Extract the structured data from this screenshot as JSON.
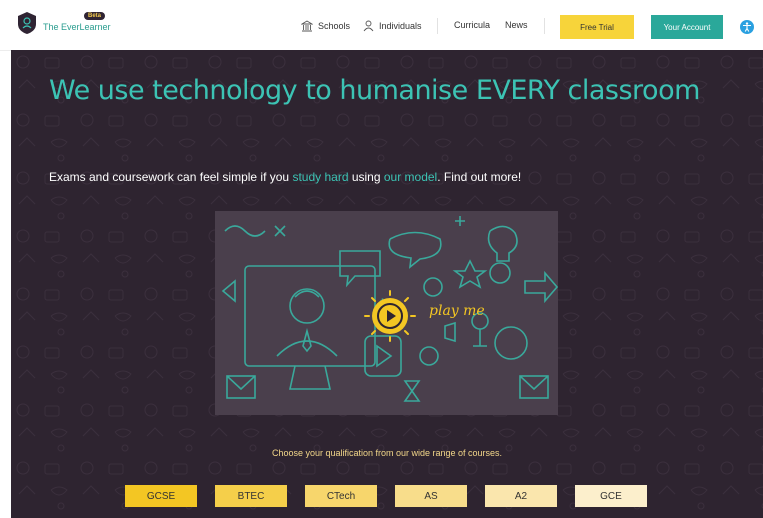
{
  "header": {
    "brand": "The EverLearner",
    "beta": "Beta",
    "nav": [
      "Schools",
      "Individuals",
      "Curricula",
      "News"
    ],
    "free_trial": "Free Trial",
    "your_account": "Your Account"
  },
  "hero": {
    "title": "We use technology to humanise EVERY classroom",
    "subtitle_a": "Exams and coursework can feel simple if you ",
    "subtitle_link1": "study hard",
    "subtitle_b": " using ",
    "subtitle_link2": "our model",
    "subtitle_c": ". Find out more!",
    "play_text": "play me",
    "choose": "Choose your qualification from our wide range of courses."
  },
  "qualifications": [
    {
      "label": "GCSE",
      "color": "#f3c623"
    },
    {
      "label": "BTEC",
      "color": "#f5cf4a"
    },
    {
      "label": "CTech",
      "color": "#f7d66c"
    },
    {
      "label": "AS",
      "color": "#f8dd8b"
    },
    {
      "label": "A2",
      "color": "#fae6ad"
    },
    {
      "label": "GCE",
      "color": "#fcefcc"
    }
  ],
  "colors": {
    "accent": "#3cc3b4",
    "background": "#2e2430",
    "yellow": "#f3c623"
  }
}
